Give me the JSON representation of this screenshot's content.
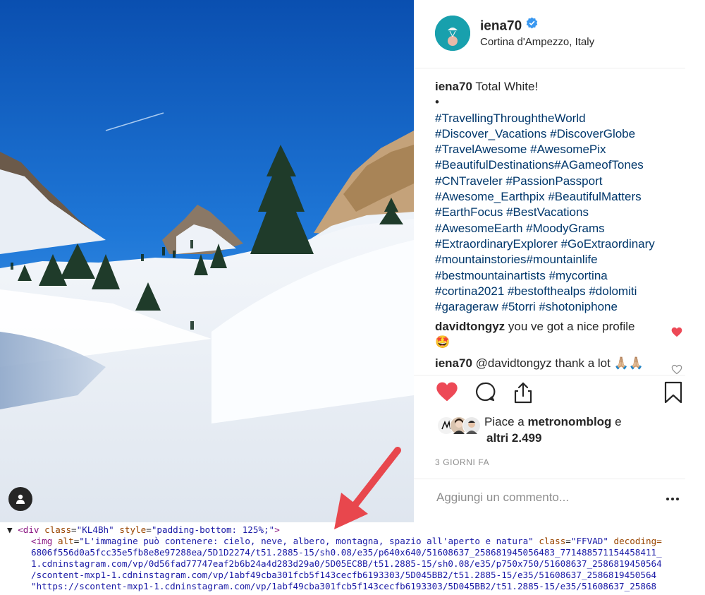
{
  "post": {
    "username": "iena70",
    "location": "Cortina d'Ampezzo, Italy",
    "caption_user": "iena70",
    "caption_text": "Total White!",
    "caption_dot": "•",
    "hashtag_lines": [
      "#TravellingThroughtheWorld",
      "#Discover_Vacations #DiscoverGlobe",
      "#TravelAwesome #AwesomePix",
      "#BeautifulDestinations#AGameofTones",
      "#CNTraveler #PassionPassport",
      "#Awesome_Earthpix #BeautifulMatters",
      "#EarthFocus #BestVacations",
      "#AwesomeEarth #MoodyGrams",
      "#ExtraordinaryExplorer #GoExtraordinary",
      "#mountainstories#mountainlife",
      "#bestmountainartists #mycortina",
      "#cortina2021 #bestofthealps #dolomiti",
      "#garageraw #5torri #shotoniphone"
    ],
    "comments": [
      {
        "user": "davidtongyz",
        "text": "you ve got a nice profile",
        "emoji": "🤩",
        "liked": true
      },
      {
        "user": "iena70",
        "text": "@davidtongyz thank a lot",
        "emoji": "🙏🏼🙏🏼",
        "liked": false
      }
    ],
    "likes_prefix": "Piace a",
    "likes_user": "metronomblog",
    "likes_conj": "e",
    "likes_others": "altri 2.499",
    "time_ago": "3 GIORNI FA",
    "comment_placeholder": "Aggiungi un commento...",
    "more_label": "•••"
  },
  "icons": {
    "heart": "heart-icon",
    "comment": "comment-icon",
    "share": "share-icon",
    "bookmark": "bookmark-icon",
    "user_tag": "user-icon",
    "verified": "verified-badge-icon"
  },
  "colors": {
    "like_red": "#ed4956",
    "link_blue": "#00376b",
    "verified_blue": "#3897f0",
    "arrow": "#e8474d"
  },
  "devtools": {
    "line1": {
      "toggle": "▼",
      "open": "<div",
      "attr1": "class",
      "val1": "\"KL4Bh\"",
      "attr2": "style",
      "val2": "\"padding-bottom: 125%;\"",
      "close": ">"
    },
    "line2": {
      "open": "<img",
      "attr1": "alt",
      "val1": "\"L'immagine può contenere: cielo, neve, albero, montagna, spazio all'aperto e natura\"",
      "attr2": "class",
      "val2": "\"FFVAD\"",
      "attr3": "decoding="
    },
    "line3": "6806f556d0a5fcc35e5fb8e8e97288ea/5D1D2274/t51.2885-15/sh0.08/e35/p640x640/51608637_258681945056483_771488571154458411_",
    "line4": "1.cdninstagram.com/vp/0d56fad77747eaf2b6b24a4d283d29a0/5D05EC8B/t51.2885-15/sh0.08/e35/p750x750/51608637_2586819450564",
    "line5": "/scontent-mxp1-1.cdninstagram.com/vp/1abf49cba301fcb5f143cecfb6193303/5D045BB2/t51.2885-15/e35/51608637_2586819450564",
    "line6": "\"https://scontent-mxp1-1.cdninstagram.com/vp/1abf49cba301fcb5f143cecfb6193303/5D045BB2/t51.2885-15/e35/51608637_25868"
  }
}
